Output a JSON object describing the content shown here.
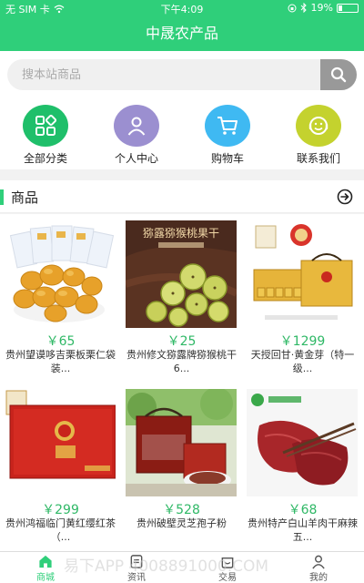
{
  "status": {
    "carrier": "无 SIM 卡",
    "time": "下午4:09",
    "battery": "19%",
    "battery_level": 0.19
  },
  "header": {
    "title": "中晟农产品"
  },
  "search": {
    "placeholder": "搜本站商品"
  },
  "quick_menu": [
    {
      "label": "全部分类",
      "icon": "category-grid-icon",
      "color": "#1fbf6a"
    },
    {
      "label": "个人中心",
      "icon": "user-icon",
      "color": "#9b8fd0"
    },
    {
      "label": "购物车",
      "icon": "cart-icon",
      "color": "#3fb9f2"
    },
    {
      "label": "联系我们",
      "icon": "smiley-icon",
      "color": "#c4d22e"
    }
  ],
  "section": {
    "title": "商品"
  },
  "products": [
    {
      "price": "￥65",
      "name": "贵州望谟哆吉栗板栗仁袋装..."
    },
    {
      "price": "￥25",
      "name": "贵州修文猕露牌猕猴桃干6..."
    },
    {
      "price": "￥1299",
      "name": "天授回甘·黄金芽（特一级..."
    },
    {
      "price": "￥299",
      "name": "贵州鸿福临门黄红缨红茶（..."
    },
    {
      "price": "￥528",
      "name": "贵州破壁灵芝孢子粉"
    },
    {
      "price": "￥68",
      "name": "贵州特产白山羊肉干麻辣五..."
    }
  ],
  "image_texts": {
    "kiwi_banner": "猕露猕猴桃果干"
  },
  "tabs": [
    {
      "label": "商城",
      "icon": "shop-icon",
      "active": true
    },
    {
      "label": "资讯",
      "icon": "news-icon",
      "active": false
    },
    {
      "label": "交易",
      "icon": "trade-icon",
      "active": false
    },
    {
      "label": "我的",
      "icon": "profile-icon",
      "active": false
    }
  ],
  "watermark": "易下APP 4008891000.COM",
  "colors": {
    "accent": "#2fcf7a",
    "price": "#2fb866"
  }
}
